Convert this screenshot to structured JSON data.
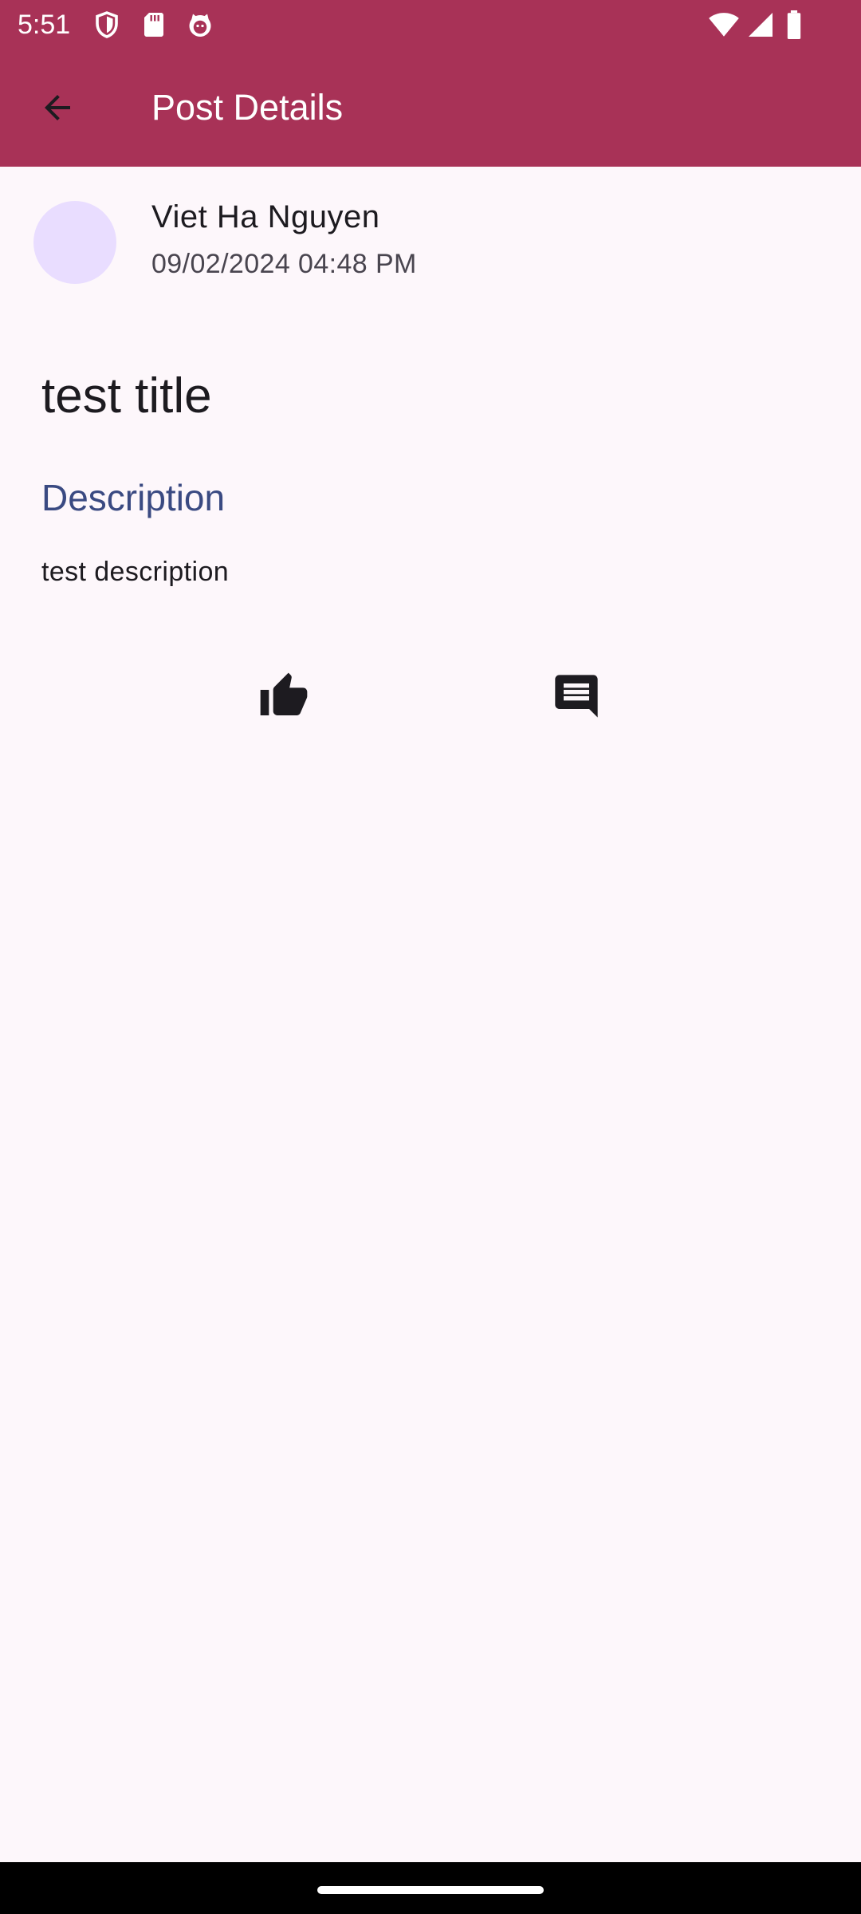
{
  "status_bar": {
    "time": "5:51",
    "left_icons": [
      "shield-icon",
      "sd-card-icon",
      "cat-face-icon"
    ],
    "right_icons": [
      "wifi-icon",
      "cellular-signal-icon",
      "battery-icon"
    ]
  },
  "toolbar": {
    "title": "Post Details",
    "back_icon": "arrow-back-icon",
    "background_color": "#a83257"
  },
  "post": {
    "author": "Viet Ha Nguyen",
    "date": "09/02/2024 04:48 PM",
    "title": "test title",
    "description_label": "Description",
    "description": "test description",
    "avatar_color": "#e9ddff"
  },
  "actions": {
    "like_icon": "thumb-up-icon",
    "comment_icon": "comment-icon"
  },
  "colors": {
    "background": "#fdf7fb",
    "section_label": "#3a4a82"
  }
}
